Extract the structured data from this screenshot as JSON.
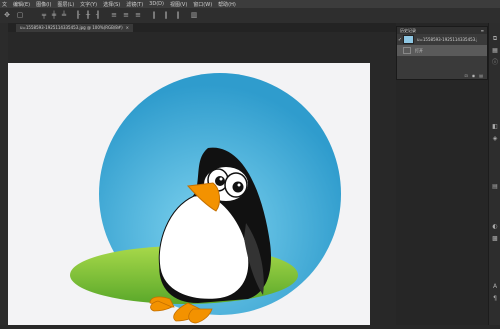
{
  "menubar": {
    "items": [
      "文",
      "编辑(E)",
      "图像(I)",
      "图层(L)",
      "文字(Y)",
      "选择(S)",
      "滤镜(T)",
      "3D(D)",
      "视图(V)",
      "窗口(W)",
      "帮助(H)"
    ]
  },
  "document": {
    "tab_title": "u=1558593-1925114335453.jpg @ 100%(RGB/8#)",
    "close": "×"
  },
  "history_panel": {
    "title": "历史记录",
    "menu": "≡",
    "snapshot_label": "u=1558593-1925114335453.jpg",
    "step_label": "打开"
  },
  "colors": {
    "sky_circle": "#4aa8d4",
    "grass": "#7cc43a",
    "beak": "#f39200",
    "bg": "#282828"
  }
}
